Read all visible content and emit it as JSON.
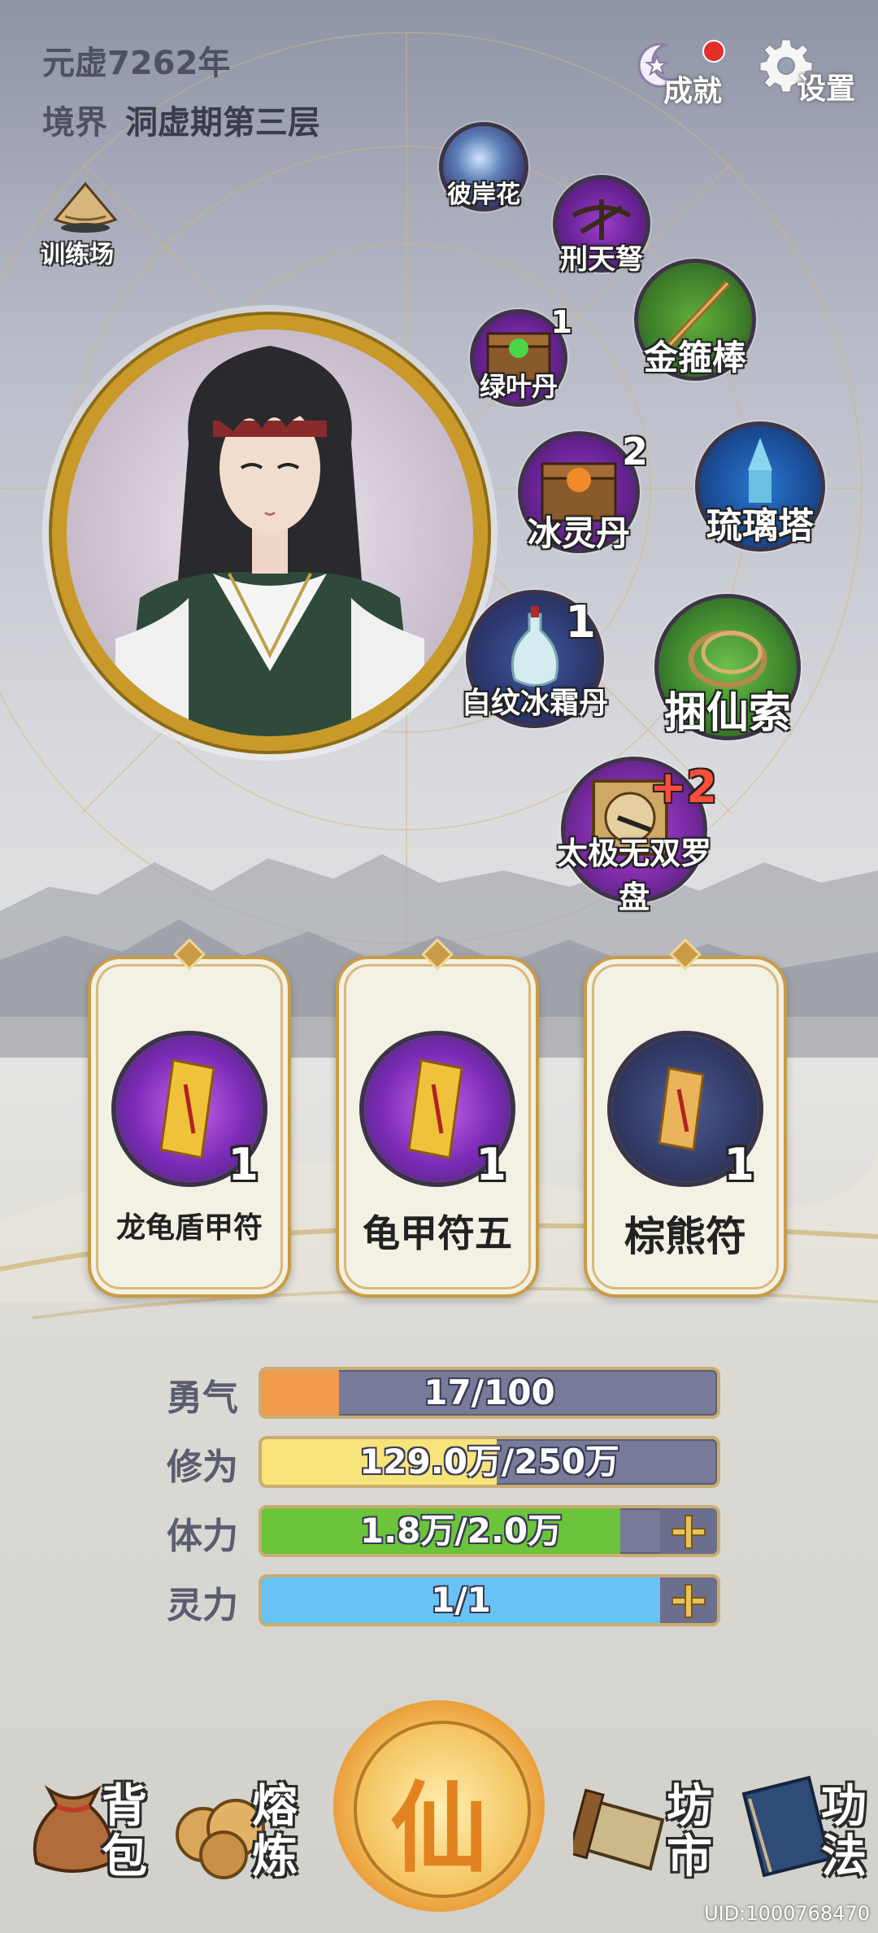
{
  "header": {
    "year_label": "元虚7262年",
    "realm_prefix": "境界",
    "realm_value": "洞虚期第三层",
    "achievement_label": "成就",
    "settings_label": "设置"
  },
  "training_label": "训练场",
  "items": [
    {
      "name": "彼岸花",
      "count": ""
    },
    {
      "name": "刑天弩",
      "count": ""
    },
    {
      "name": "金箍棒",
      "count": ""
    },
    {
      "name": "绿叶丹",
      "count": "1"
    },
    {
      "name": "冰灵丹",
      "count": "2"
    },
    {
      "name": "琉璃塔",
      "count": ""
    },
    {
      "name": "白纹冰霜丹",
      "count": "1"
    },
    {
      "name": "捆仙索",
      "count": ""
    },
    {
      "name": "太极无双罗盘",
      "count": "+2"
    }
  ],
  "talismans": [
    {
      "name": "龙龟盾甲符",
      "count": "1"
    },
    {
      "name": "龟甲符五",
      "count": "1"
    },
    {
      "name": "棕熊符",
      "count": "1"
    }
  ],
  "stats": [
    {
      "label": "勇气",
      "text": "17/100",
      "fraction": 0.17,
      "color": "#f09a4e"
    },
    {
      "label": "修为",
      "text": "129.0万/250万",
      "fraction": 0.516,
      "color": "#f7e37a"
    },
    {
      "label": "体力",
      "text": "1.8万/2.0万",
      "fraction": 0.9,
      "color": "#6cc43a"
    },
    {
      "label": "灵力",
      "text": "1/1",
      "fraction": 1.0,
      "color": "#67c3f6"
    }
  ],
  "nav": {
    "bag_label": "背包",
    "smelt_label": "熔炼",
    "center_label": "仙",
    "market_label": "坊市",
    "skill_label": "功法"
  },
  "uid": "UID:1000768470"
}
